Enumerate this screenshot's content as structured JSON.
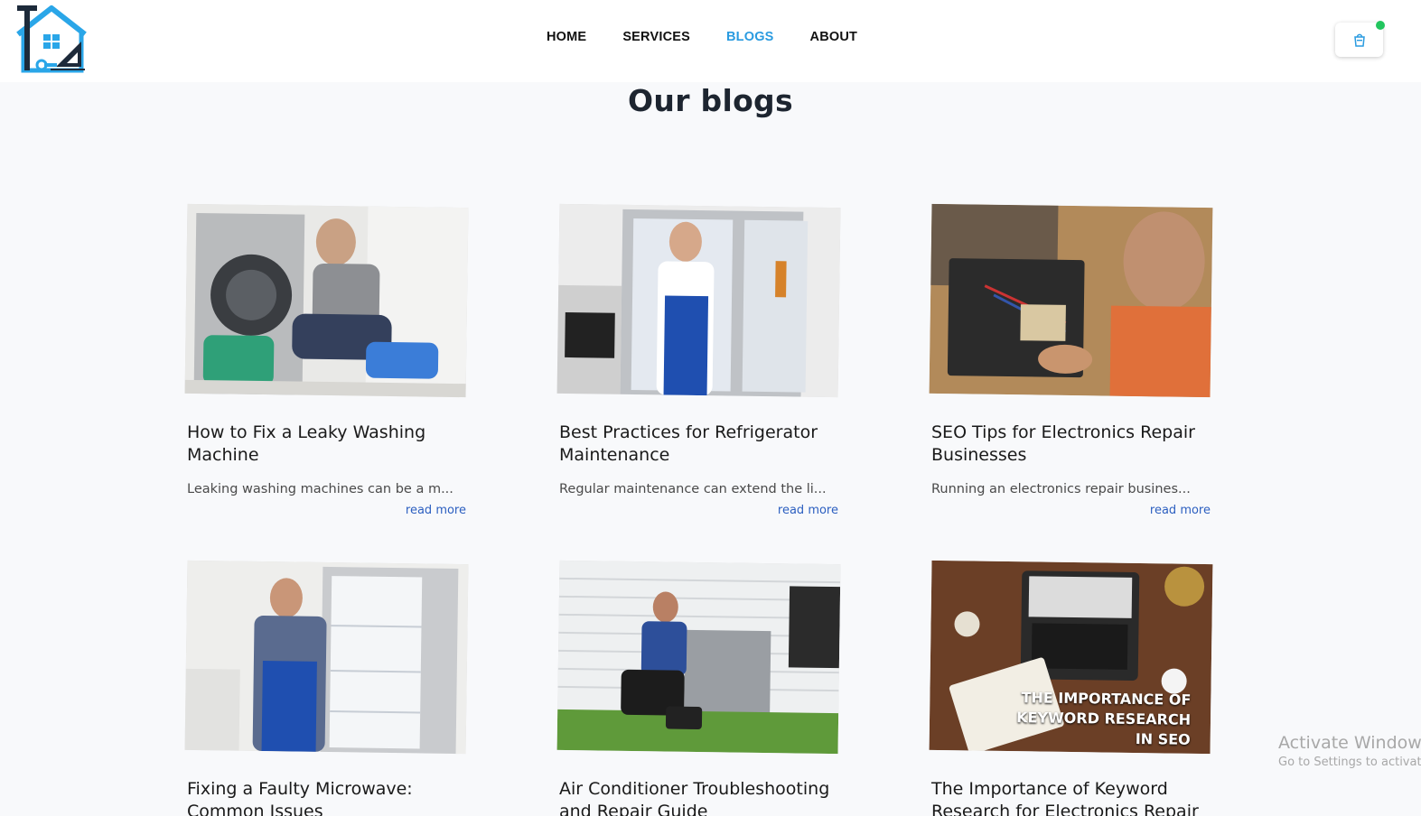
{
  "logo": {
    "alt_text": "BEST LEVEL SERVICE"
  },
  "nav": {
    "items": [
      {
        "label": "HOME",
        "active": false
      },
      {
        "label": "SERVICES",
        "active": false
      },
      {
        "label": "BLOGS",
        "active": true
      },
      {
        "label": "ABOUT",
        "active": false
      }
    ]
  },
  "cart": {
    "icon": "shopping-bag-icon",
    "badge_color": "#22c55e"
  },
  "colors": {
    "accent": "#2a9be0",
    "link": "#2c5fc0",
    "background": "#f8f9fb"
  },
  "page": {
    "title": "Our blogs"
  },
  "posts": [
    {
      "title": "How to Fix a Leaky Washing Machine",
      "excerpt": "Leaking washing machines can be a m...",
      "read_more": "read more",
      "image": "technician-washing-machine-photo"
    },
    {
      "title": "Best Practices for Refrigerator Maintenance",
      "excerpt": "Regular maintenance can extend the li...",
      "read_more": "read more",
      "image": "technician-refrigerator-thumbs-up-photo"
    },
    {
      "title": "SEO Tips for Electronics Repair Businesses",
      "excerpt": "Running an electronics repair busines...",
      "read_more": "read more",
      "image": "electronics-soldering-photo"
    },
    {
      "title": "Fixing a Faulty Microwave: Common Issues",
      "excerpt": "",
      "read_more": "",
      "image": "technician-open-fridge-photo"
    },
    {
      "title": "Air Conditioner Troubleshooting and Repair Guide",
      "excerpt": "",
      "read_more": "",
      "image": "ac-outdoor-unit-technician-photo"
    },
    {
      "title": "The Importance of Keyword Research for Electronics Repair",
      "excerpt": "",
      "read_more": "",
      "image": "laptop-keyword-research-photo",
      "image_caption": "THE IMPORTANCE OF KEYWORD RESEARCH IN SEO"
    }
  ],
  "os_watermark": {
    "line1": "Activate Windows",
    "line2": "Go to Settings to activate Windows."
  }
}
